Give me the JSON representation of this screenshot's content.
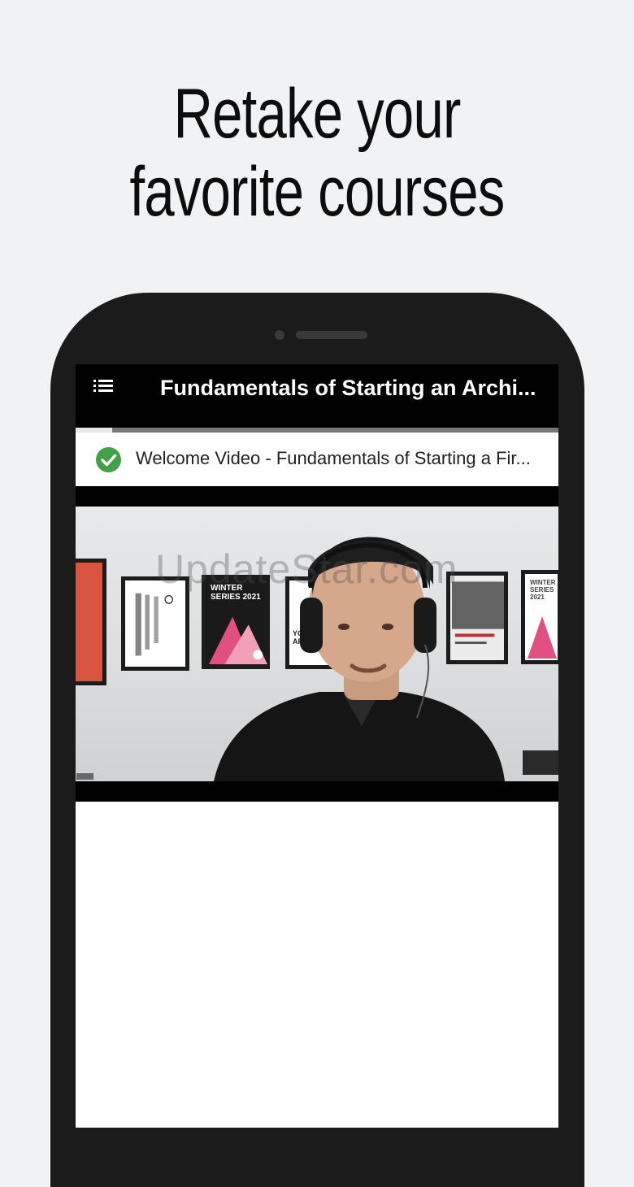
{
  "headline": {
    "line1": "Retake your",
    "line2": "favorite courses"
  },
  "app_bar": {
    "menu_icon": "list-menu-icon",
    "title": "Fundamentals of Starting an Archi..."
  },
  "progress": {
    "fraction": 0.075
  },
  "lesson": {
    "status_icon": "check-circle-icon",
    "status_color": "#43a047",
    "title": "Welcome Video - Fundamentals of Starting a Fir..."
  },
  "video": {
    "watermark": "UpdateStar.com",
    "posters": [
      {
        "text": "WINTER SERIES 2021"
      },
      {
        "text": "YOUNG ARCHITECT"
      },
      {
        "text": "WINTER SERIES 2021"
      }
    ]
  }
}
